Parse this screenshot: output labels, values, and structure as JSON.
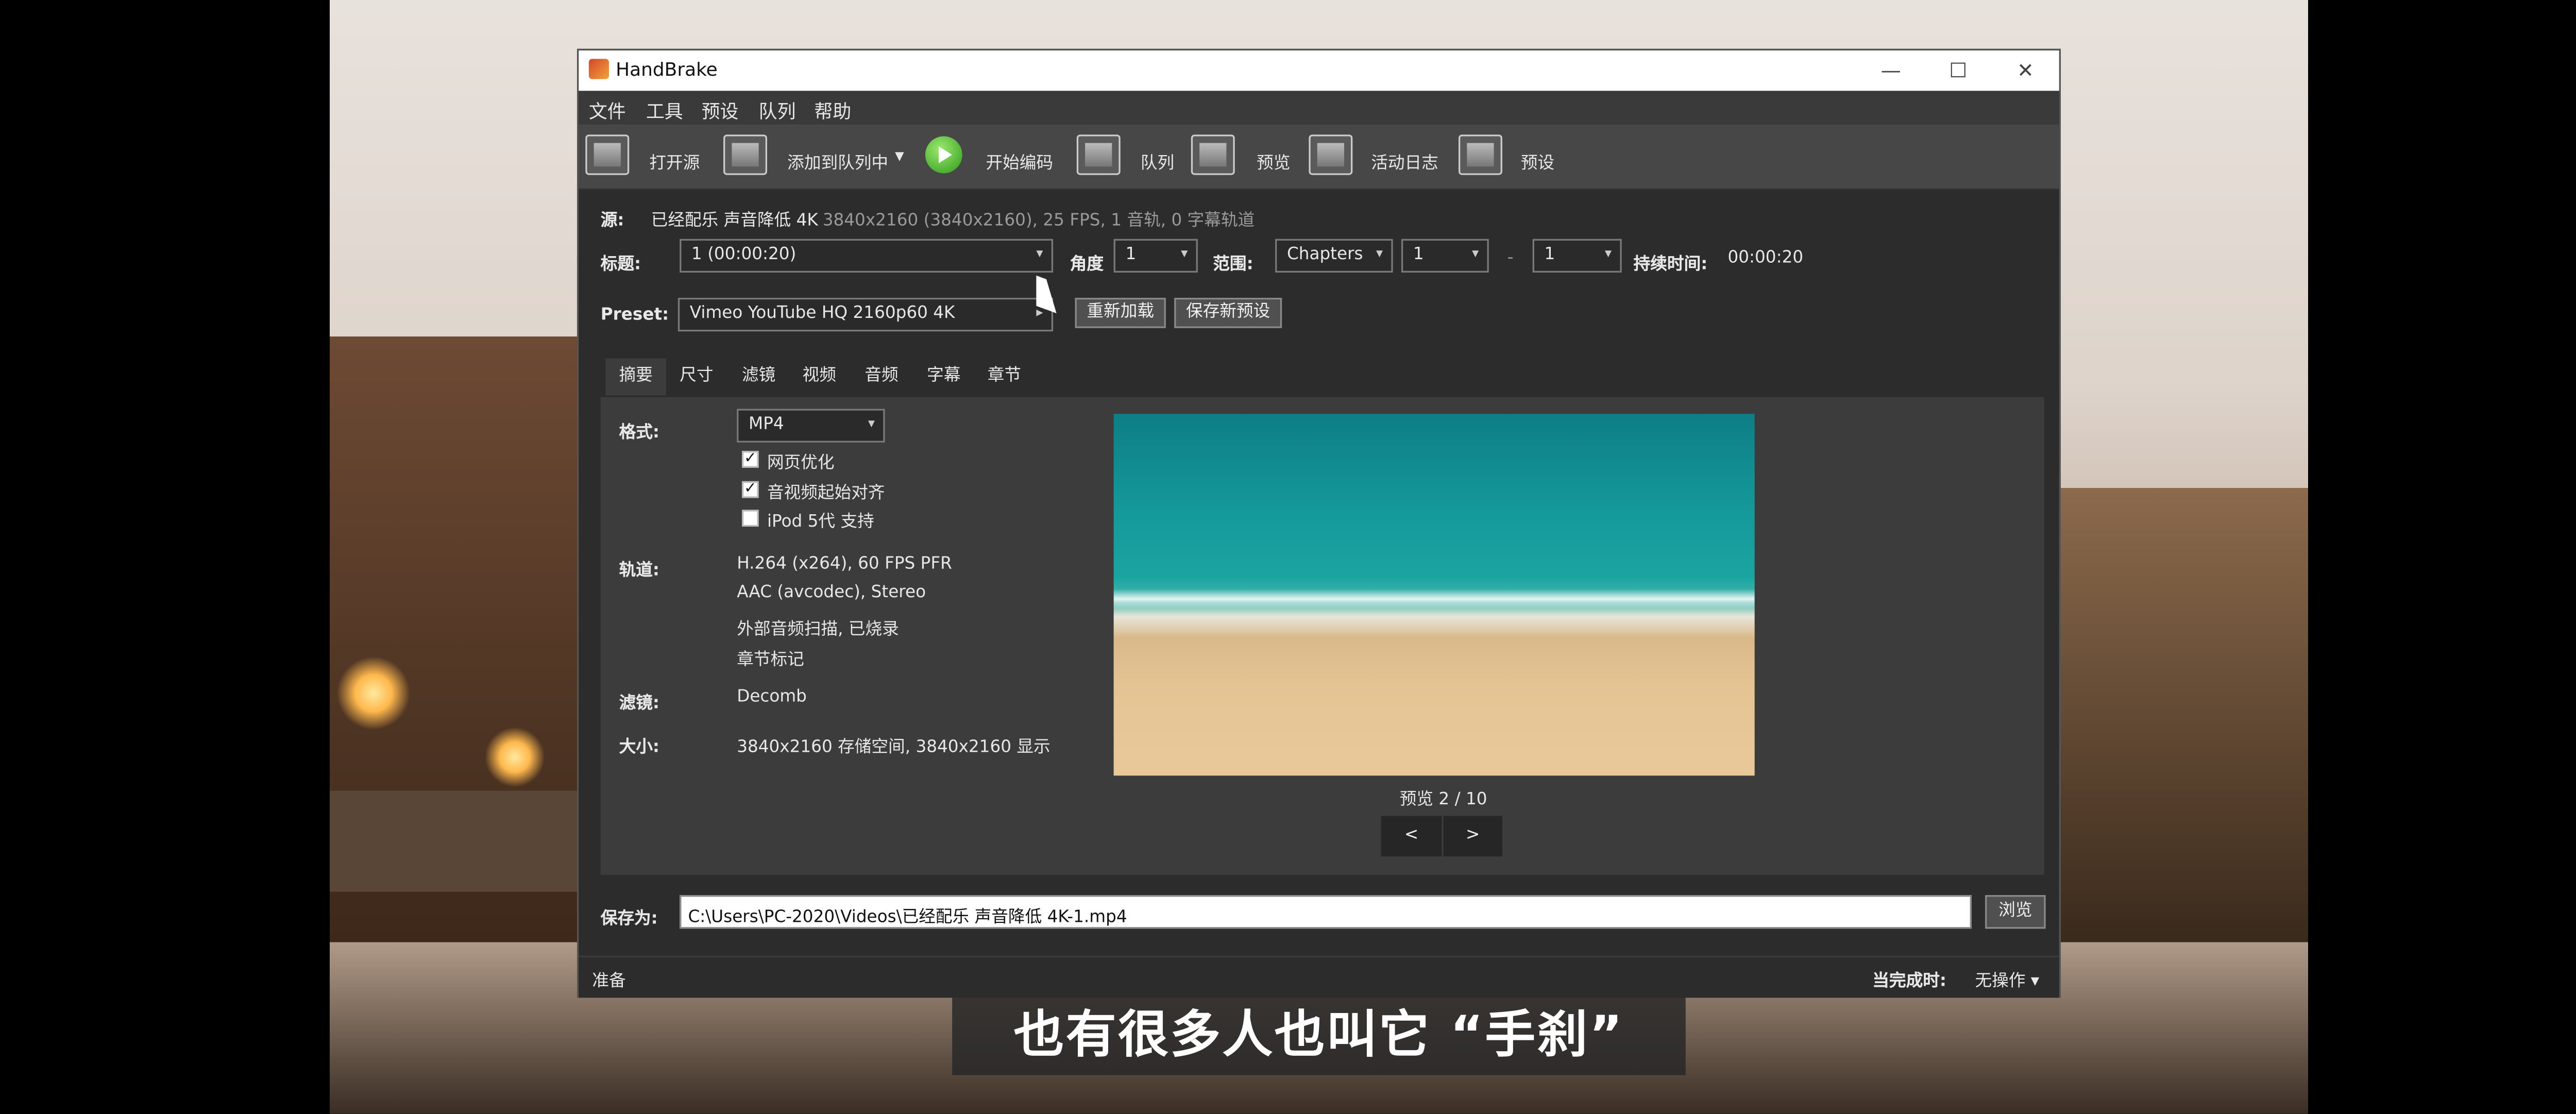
{
  "window": {
    "title": "HandBrake",
    "controls": {
      "minimize": "—",
      "maximize": "☐",
      "close": "✕"
    }
  },
  "menu": [
    "文件",
    "工具",
    "预设",
    "队列",
    "帮助"
  ],
  "toolbar": {
    "open_source": "打开源",
    "add_to_queue": "添加到队列中",
    "start_encode": "开始编码",
    "queue": "队列",
    "preview": "预览",
    "activity_log": "活动日志",
    "presets": "预设"
  },
  "source": {
    "label": "源:",
    "name": "已经配乐 声音降低 4K",
    "info": "3840x2160 (3840x2160), 25 FPS, 1 音轨, 0 字幕轨道"
  },
  "title_row": {
    "title_label": "标题:",
    "title_value": "1  (00:00:20)",
    "angle_label": "角度",
    "angle_value": "1",
    "range_label": "范围:",
    "range_type": "Chapters",
    "range_start": "1",
    "range_dash": "-",
    "range_end": "1",
    "duration_label": "持续时间:",
    "duration_value": "00:00:20"
  },
  "preset": {
    "label": "Preset:",
    "value": "Vimeo YouTube HQ 2160p60 4K",
    "reload": "重新加载",
    "save_new": "保存新预设"
  },
  "tabs": [
    "摘要",
    "尺寸",
    "滤镜",
    "视频",
    "音频",
    "字幕",
    "章节"
  ],
  "active_tab": "摘要",
  "summary": {
    "format_label": "格式:",
    "format_value": "MP4",
    "options": [
      {
        "label": "网页优化",
        "checked": true
      },
      {
        "label": "音视频起始对齐",
        "checked": true
      },
      {
        "label": "iPod 5代 支持",
        "checked": false
      }
    ],
    "tracks_label": "轨道:",
    "tracks": [
      "H.264 (x264), 60 FPS PFR",
      "AAC (avcodec), Stereo",
      "外部音频扫描, 已烧录",
      "章节标记"
    ],
    "filters_label": "滤镜:",
    "filters_value": "Decomb",
    "size_label": "大小:",
    "size_value": "3840x2160 存储空间, 3840x2160 显示"
  },
  "preview_panel": {
    "caption": "预览 2 / 10",
    "prev": "<",
    "next": ">"
  },
  "save": {
    "label": "保存为:",
    "path": "C:\\Users\\PC-2020\\Videos\\已经配乐 声音降低 4K-1.mp4",
    "browse": "浏览"
  },
  "status": {
    "text": "准备",
    "when_done_label": "当完成时:",
    "when_done_value": "无操作"
  },
  "video_subtitle": "也有很多人也叫它 “手刹”"
}
